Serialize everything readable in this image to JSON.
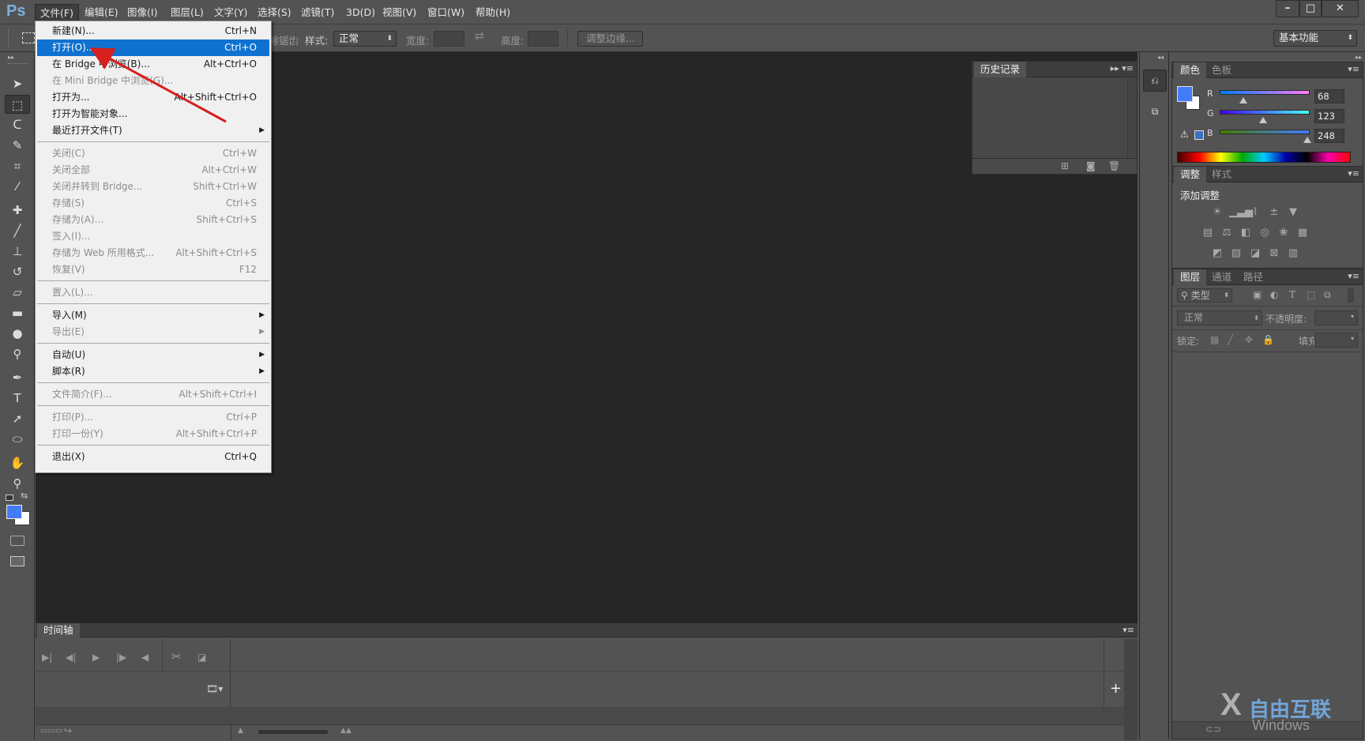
{
  "app": {
    "logo": "Ps"
  },
  "menubar": {
    "items": [
      "文件(F)",
      "编辑(E)",
      "图像(I)",
      "图层(L)",
      "文字(Y)",
      "选择(S)",
      "滤镜(T)",
      "3D(D)",
      "视图(V)",
      "窗口(W)",
      "帮助(H)"
    ],
    "active_index": 0
  },
  "window_controls": {
    "minimize": "–",
    "maximize": "□",
    "close": "✕"
  },
  "options_bar": {
    "antialias_label": "消除锯齿",
    "style_label": "样式:",
    "style_value": "正常",
    "width_label": "宽度:",
    "width_value": "",
    "swap_icon": "⇄",
    "height_label": "高度:",
    "height_value": "",
    "refine_edge_button": "调整边缘...",
    "workspace_value": "基本功能"
  },
  "file_menu": {
    "items": [
      {
        "label": "新建(N)...",
        "shortcut": "Ctrl+N",
        "enabled": true
      },
      {
        "label": "打开(O)...",
        "shortcut": "Ctrl+O",
        "enabled": true,
        "highlighted": true
      },
      {
        "label": "在 Bridge 中浏览(B)...",
        "shortcut": "Alt+Ctrl+O",
        "enabled": true
      },
      {
        "label": "在 Mini Bridge 中浏览(G)...",
        "shortcut": "",
        "enabled": false
      },
      {
        "label": "打开为...",
        "shortcut": "Alt+Shift+Ctrl+O",
        "enabled": true
      },
      {
        "label": "打开为智能对象...",
        "shortcut": "",
        "enabled": true
      },
      {
        "label": "最近打开文件(T)",
        "shortcut": "",
        "enabled": true,
        "submenu": true
      },
      {
        "separator": true
      },
      {
        "label": "关闭(C)",
        "shortcut": "Ctrl+W",
        "enabled": false
      },
      {
        "label": "关闭全部",
        "shortcut": "Alt+Ctrl+W",
        "enabled": false
      },
      {
        "label": "关闭并转到 Bridge...",
        "shortcut": "Shift+Ctrl+W",
        "enabled": false
      },
      {
        "label": "存储(S)",
        "shortcut": "Ctrl+S",
        "enabled": false
      },
      {
        "label": "存储为(A)...",
        "shortcut": "Shift+Ctrl+S",
        "enabled": false
      },
      {
        "label": "签入(I)...",
        "shortcut": "",
        "enabled": false
      },
      {
        "label": "存储为 Web 所用格式...",
        "shortcut": "Alt+Shift+Ctrl+S",
        "enabled": false
      },
      {
        "label": "恢复(V)",
        "shortcut": "F12",
        "enabled": false
      },
      {
        "separator": true
      },
      {
        "label": "置入(L)...",
        "shortcut": "",
        "enabled": false
      },
      {
        "separator": true
      },
      {
        "label": "导入(M)",
        "shortcut": "",
        "enabled": true,
        "submenu": true
      },
      {
        "label": "导出(E)",
        "shortcut": "",
        "enabled": false,
        "submenu": true
      },
      {
        "separator": true
      },
      {
        "label": "自动(U)",
        "shortcut": "",
        "enabled": true,
        "submenu": true
      },
      {
        "label": "脚本(R)",
        "shortcut": "",
        "enabled": true,
        "submenu": true
      },
      {
        "separator": true
      },
      {
        "label": "文件简介(F)...",
        "shortcut": "Alt+Shift+Ctrl+I",
        "enabled": false
      },
      {
        "separator": true
      },
      {
        "label": "打印(P)...",
        "shortcut": "Ctrl+P",
        "enabled": false
      },
      {
        "label": "打印一份(Y)",
        "shortcut": "Alt+Shift+Ctrl+P",
        "enabled": false
      },
      {
        "separator": true
      },
      {
        "label": "退出(X)",
        "shortcut": "Ctrl+Q",
        "enabled": true
      }
    ]
  },
  "tools": [
    {
      "name": "move-tool",
      "glyph": "➤"
    },
    {
      "name": "marquee-tool",
      "glyph": "⬚",
      "selected": true
    },
    {
      "name": "lasso-tool",
      "glyph": "ᑕ"
    },
    {
      "name": "quick-selection-tool",
      "glyph": "✎"
    },
    {
      "name": "crop-tool",
      "glyph": "⌗"
    },
    {
      "name": "eyedropper-tool",
      "glyph": "⁄"
    },
    {
      "name": "healing-brush-tool",
      "glyph": "✚"
    },
    {
      "name": "brush-tool",
      "glyph": "╱"
    },
    {
      "name": "clone-stamp-tool",
      "glyph": "⊥"
    },
    {
      "name": "history-brush-tool",
      "glyph": "↺"
    },
    {
      "name": "eraser-tool",
      "glyph": "▱"
    },
    {
      "name": "gradient-tool",
      "glyph": "▬"
    },
    {
      "name": "blur-tool",
      "glyph": "●"
    },
    {
      "name": "dodge-tool",
      "glyph": "⚲"
    },
    {
      "name": "pen-tool",
      "glyph": "✒"
    },
    {
      "name": "type-tool",
      "glyph": "T"
    },
    {
      "name": "path-selection-tool",
      "glyph": "➚"
    },
    {
      "name": "ellipse-tool",
      "glyph": "⬭"
    },
    {
      "name": "hand-tool",
      "glyph": "✋"
    },
    {
      "name": "zoom-tool",
      "glyph": "⚲"
    }
  ],
  "colors": {
    "foreground": "#447bf8",
    "background": "#ffffff",
    "accent": "#0f72d0",
    "arrow": "#d61f1f"
  },
  "history_panel": {
    "tab": "历史记录"
  },
  "color_panel": {
    "tabs": [
      "颜色",
      "色板"
    ],
    "r_label": "R",
    "g_label": "G",
    "b_label": "B",
    "r": 68,
    "g": 123,
    "b": 248,
    "r_value": "68",
    "g_value": "123",
    "b_value": "248"
  },
  "adjustments_panel": {
    "tabs": [
      "调整",
      "样式"
    ],
    "title": "添加调整",
    "icons": [
      [
        "brightness-contrast",
        "levels",
        "curves",
        "exposure",
        "gradient-map"
      ],
      [
        "vibrance",
        "color-balance",
        "black-white",
        "photo-filter",
        "channel-mixer",
        "color-lookup"
      ],
      [
        "invert",
        "posterize",
        "threshold",
        "selective-color",
        "gradient"
      ]
    ]
  },
  "layers_panel": {
    "tabs": [
      "图层",
      "通道",
      "路径"
    ],
    "filter_label": "类型",
    "blend_mode": "正常",
    "opacity_label": "不透明度:",
    "lock_label": "锁定:",
    "fill_label": "填充:"
  },
  "timeline": {
    "tab": "时间轴"
  },
  "watermark": {
    "brand": "自由互联",
    "sub": "Windows"
  }
}
